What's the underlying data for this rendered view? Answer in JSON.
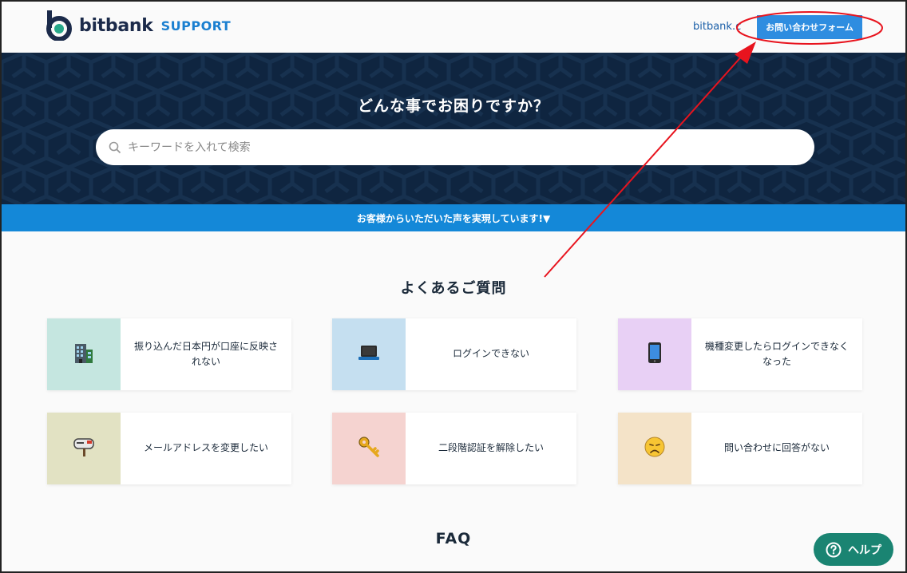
{
  "header": {
    "logo_text": "bitbank",
    "logo_support": "SUPPORT",
    "bitbank_link": "bitbank.cc",
    "contact_button": "お問い合わせフォーム"
  },
  "hero": {
    "title": "どんな事でお困りですか？",
    "search_placeholder": "キーワードを入れて検索"
  },
  "banner": {
    "text": "お客様からいただいた声を実現しています!▼"
  },
  "faq_section": {
    "title": "よくあるご質問",
    "cards": [
      {
        "label": "振り込んだ日本円が口座に反映されない",
        "icon": "office-building-icon",
        "bg": "#c5e6e0"
      },
      {
        "label": "ログインできない",
        "icon": "laptop-icon",
        "bg": "#c5dff0"
      },
      {
        "label": "機種変更したらログインできなくなった",
        "icon": "smartphone-icon",
        "bg": "#e8d0f5"
      },
      {
        "label": "メールアドレスを変更したい",
        "icon": "mailbox-icon",
        "bg": "#e2e2c3"
      },
      {
        "label": "二段階認証を解除したい",
        "icon": "key-icon",
        "bg": "#f5d3d0"
      },
      {
        "label": "問い合わせに回答がない",
        "icon": "sad-face-icon",
        "bg": "#f4e3c8"
      }
    ]
  },
  "faq_heading": "FAQ",
  "help_button": "ヘルプ",
  "colors": {
    "navy": "#0f2540",
    "accent_blue": "#2e8de0",
    "banner_blue": "#1488d8",
    "help_green": "#1a8472",
    "annotation_red": "#e8141e"
  }
}
